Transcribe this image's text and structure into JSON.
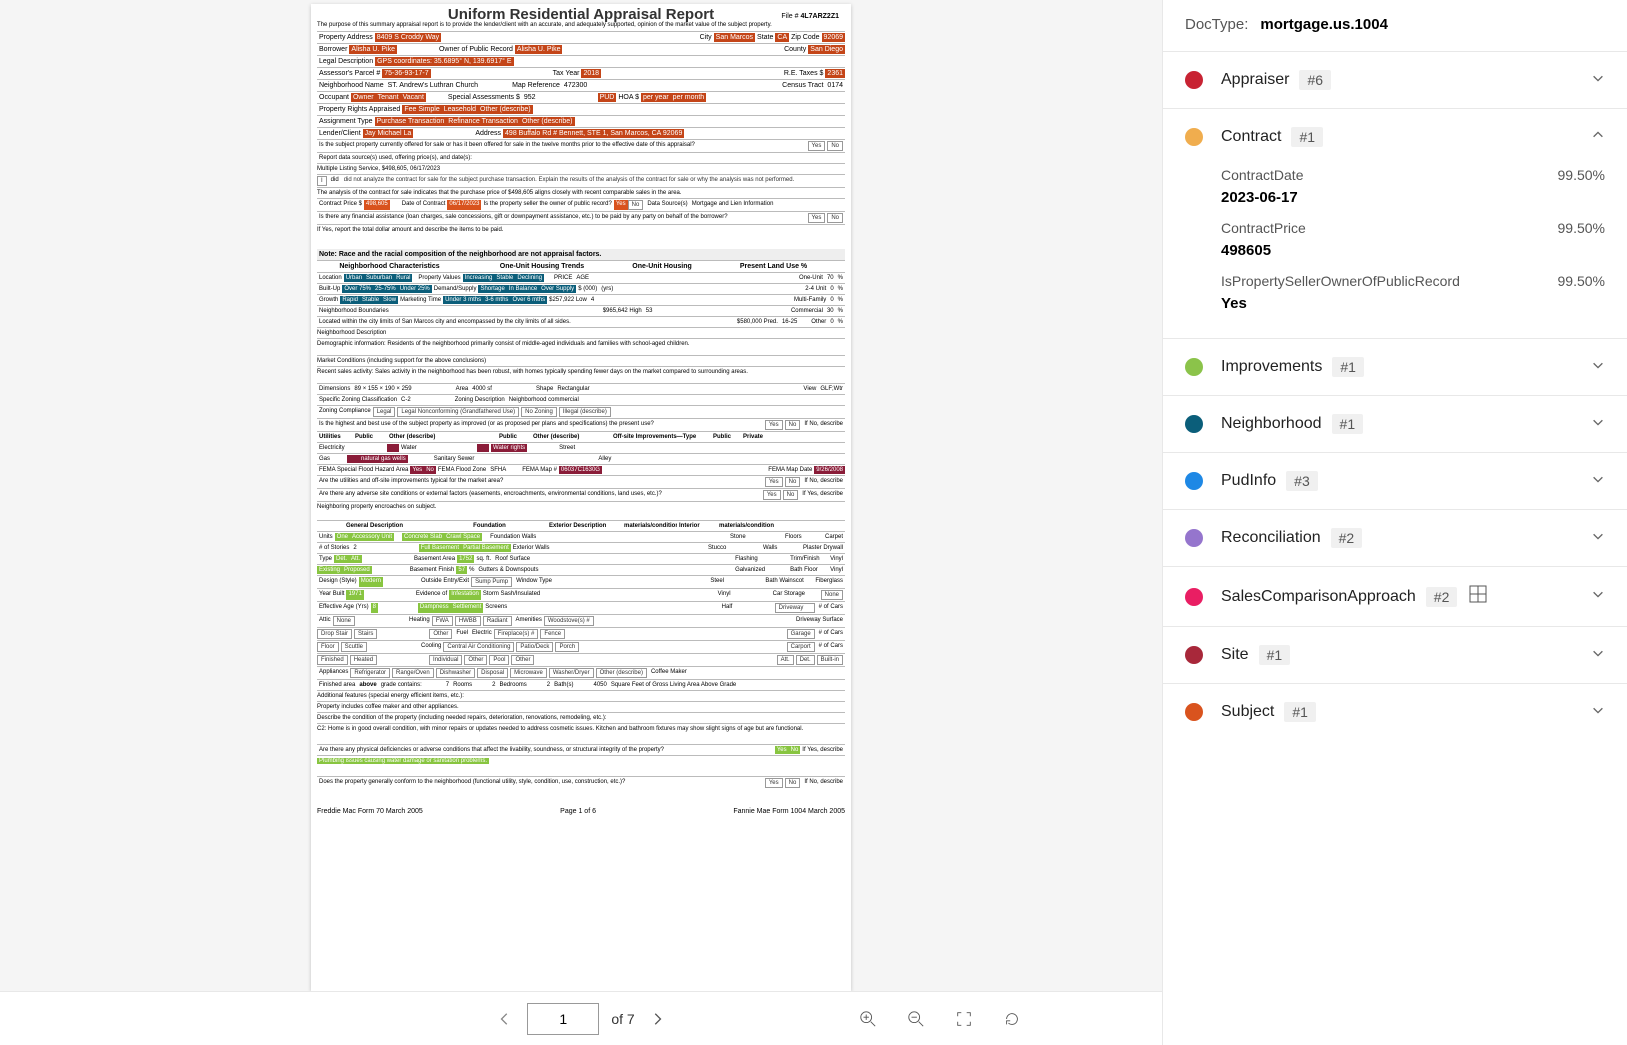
{
  "docType": {
    "label": "DocType:",
    "value": "mortgage.us.1004"
  },
  "pager": {
    "current": "1",
    "total": "7",
    "ofLabel": "of"
  },
  "form": {
    "title": "Uniform Residential Appraisal Report",
    "fileLabel": "File #",
    "fileNo": "4L7ARZ2Z1",
    "intro": "The purpose of this summary appraisal report is to provide the lender/client with an accurate, and adequately supported, opinion of the market value of the subject property.",
    "subject": {
      "propAddrLabel": "Property Address",
      "propAddr": "8409 S Croddy Way",
      "cityLabel": "City",
      "city": "San Marcos",
      "stateLabel": "State",
      "state": "CA",
      "zipLabel": "Zip Code",
      "zip": "92069",
      "borrowerLabel": "Borrower",
      "borrower": "Alisha U. Pike",
      "ownerLabel": "Owner of Public Record",
      "owner": "Alisha U. Pike",
      "countyLabel": "County",
      "county": "San Diego",
      "legalLabel": "Legal Description",
      "legal": "GPS coordinates: 35.6895° N, 139.6917° E",
      "assessorLabel": "Assessor's Parcel #",
      "assessor": "75-36-93-17-7",
      "taxYrLabel": "Tax Year",
      "taxYr": "2018",
      "reTaxLabel": "R.E. Taxes $",
      "reTax": "2361",
      "nbhdLabel": "Neighborhood Name",
      "nbhd": "ST. Andrew's Luthran Church",
      "mapRefLabel": "Map Reference",
      "mapRef": "472300",
      "censusLabel": "Census Tract",
      "census": "0174",
      "occupantLabel": "Occupant",
      "occ1": "Owner",
      "occ2": "Tenant",
      "occ3": "Vacant",
      "assessLabel": "Special Assessments $",
      "assess": "952",
      "pudLabel": "PUD",
      "hoaLabel": "HOA $",
      "hoaPer1": "per year",
      "hoaPer2": "per month",
      "rightsLabel": "Property Rights Appraised",
      "rights1": "Fee Simple",
      "rights2": "Leasehold",
      "rights3": "Other (describe)",
      "assignLabel": "Assignment Type",
      "assign1": "Purchase Transaction",
      "assign2": "Refinance Transaction",
      "assign3": "Other (describe)",
      "lenderLabel": "Lender/Client",
      "lender": "Jay Michael La",
      "addrLabel": "Address",
      "lenderAddr": "498 Buffalo Rd # Bennett, STE 1, San Marcos, CA 92069",
      "offered": "Is the subject property currently offered for sale or has it been offered for sale in the twelve months prior to the effective date of this appraisal?",
      "yes": "Yes",
      "no": "No",
      "sourcesLabel": "Report data source(s) used, offering price(s), and date(s):",
      "sources": "Multiple Listing Service, $498,605, 06/17/2023"
    },
    "contract": {
      "analyze": "I",
      "didnot": "did",
      "didnotAnalyze": "did not analyze the contract for sale for the subject purchase transaction. Explain the results of the analysis of the contract for sale or why the analysis was not performed.",
      "analysisText": "The analysis of the contract for sale indicates that the purchase price of $498,605 aligns closely with recent comparable sales in the area.",
      "priceLabel": "Contract Price $",
      "price": "498,605",
      "dateLabel": "Date of Contract",
      "date": "06/17/2023",
      "sellerOwnerLabel": "Is the property seller the owner of public record?",
      "sellerYes": "Yes",
      "sellerNo": "No",
      "dataSourceLabel": "Data Source(s)",
      "dataSource": "Mortgage and Lien Information",
      "finAssist": "Is there any financial assistance (loan charges, sale concessions, gift or downpayment assistance, etc.) to be paid by any party on behalf of the borrower?",
      "ifYes": "If Yes, report the total dollar amount and describe the items to be paid."
    },
    "nbhd": {
      "note": "Note: Race and the racial composition of the neighborhood are not appraisal factors.",
      "h1": "Neighborhood Characteristics",
      "h2": "One-Unit Housing Trends",
      "h3": "One-Unit Housing",
      "h4": "Present Land Use %",
      "locLabel": "Location",
      "urban": "Urban",
      "suburban": "Suburban",
      "rural": "Rural",
      "valLabel": "Property Values",
      "inc": "Increasing",
      "stab": "Stable",
      "dec": "Declining",
      "priceH": "PRICE",
      "ageH": "AGE",
      "oneUnit": "One-Unit",
      "oneUnitV": "70",
      "pct": "%",
      "builtLabel": "Built-Up",
      "o75": "Over 75%",
      "b25": "25-75%",
      "u25": "Under 25%",
      "dsLabel": "Demand/Supply",
      "short": "Shortage",
      "bal": "In Balance",
      "over": "Over Supply",
      "k000": "$ (000)",
      "yrs": "(yrs)",
      "twoFour": "2-4 Unit",
      "twoFourV": "0",
      "growthLabel": "Growth",
      "rapid": "Rapid",
      "stable": "Stable",
      "slow": "Slow",
      "mktLabel": "Marketing Time",
      "u3": "Under 3 mths",
      "b36": "3-6 mths",
      "o6": "Over 6 mths",
      "lowL": "$257,922 Low",
      "lowR": "4",
      "multi": "Multi-Family",
      "multiV": "0",
      "highL": "$965,642 High",
      "highR": "53",
      "comm": "Commercial",
      "commV": "30",
      "predL": "$580,000 Pred.",
      "predR": "16-25",
      "other": "Other",
      "otherV": "0",
      "boundLabel": "Neighborhood Boundaries",
      "bound": "Located within the city limits of San Marcos city and encompassed by the city limits of all sides.",
      "descLabel": "Neighborhood Description",
      "desc": "Demographic information: Residents of the neighborhood primarily consist of middle-aged individuals and families with school-aged children.",
      "mktCondLabel": "Market Conditions (including support for the above conclusions)",
      "mktCond": "Recent sales activity: Sales activity in the neighborhood has been robust, with homes typically spending fewer days on the market compared to surrounding areas."
    },
    "site": {
      "dimLabel": "Dimensions",
      "dim": "89 × 155 × 190 × 259",
      "areaLabel": "Area",
      "area": "4000 sf",
      "shapeLabel": "Shape",
      "shape": "Rectangular",
      "viewLabel": "View",
      "view": "GLF;Wtr",
      "zoneLabel": "Specific Zoning Classification",
      "zone": "C-2",
      "zoneDescLabel": "Zoning Description",
      "zoneDesc": "Neighborhood commercial",
      "zcLabel": "Zoning Compliance",
      "leg": "Legal",
      "legnc": "Legal Nonconforming (Grandfathered Use)",
      "noz": "No Zoning",
      "illeg": "Illegal (describe)",
      "hbLabel": "Is the highest and best use of the subject property as improved (or as proposed per plans and specifications) the present use?",
      "utilH": "Utilities",
      "pubH": "Public",
      "othH": "Other (describe)",
      "offH": "Off-site Improvements—Type",
      "privH": "Private",
      "elec": "Electricity",
      "water": "Water",
      "street": "Street",
      "gas": "Gas",
      "gasOth": "natural gas wells",
      "san": "Sanitary Sewer",
      "waterOth": "Water rights",
      "alley": "Alley",
      "femaLabel": "FEMA Special Flood Hazard Area",
      "femaZone": "FEMA Flood Zone",
      "femaZoneV": "SFHA",
      "femaMap": "FEMA Map #",
      "femaMapV": "06037C1630G",
      "femaDate": "FEMA Map Date",
      "femaDateV": "9/26/2008",
      "utilQ": "Are the utilities and off-site improvements typical for the market area?",
      "advQ": "Are there any adverse site conditions or external factors (easements, encroachments, environmental conditions, land uses, etc.)?",
      "advIfNo": "If No, describe",
      "encroach": "Neighboring property encroaches on subject."
    },
    "impr": {
      "gdH": "General Description",
      "fndH": "Foundation",
      "extH": "Exterior Description",
      "mcH": "materials/condition",
      "intH": "Interior",
      "unitsLabel": "Units",
      "one": "One",
      "accLabel": "Accessory Unit",
      "concLabel": "Concrete Slab",
      "crawlLabel": "Crawl Space",
      "fwLabel": "Foundation Walls",
      "fwV": "Stone",
      "flLabel": "Floors",
      "flV": "Carpet",
      "storyLabel": "# of Stories",
      "storyV": "2",
      "fullBLabel": "Full Basement",
      "partBLabel": "Partial Basement",
      "ewLabel": "Exterior Walls",
      "ewV": "Stucco",
      "wLabel": "Walls",
      "wV": "Plaster Drywall",
      "typeLabel": "Type",
      "det": "Det.",
      "att": "Att.",
      "baLabel": "Basement Area",
      "baV": "1752",
      "sqft": "sq. ft.",
      "rsLabel": "Roof Surface",
      "rsV": "Flashing",
      "tfLabel": "Trim/Finish",
      "tfV": "Vinyl",
      "exLabel": "Existing",
      "propLabel": "Proposed",
      "bfLabel": "Basement Finish",
      "bfV": "57",
      "pct": "%",
      "gdLabel": "Gutters & Downspouts",
      "gdV": "Galvanized",
      "bflLabel": "Bath Floor",
      "bflV": "Vinyl",
      "dsLabel": "Design (Style)",
      "dsV": "Modern",
      "oeLabel": "Outside Entry/Exit",
      "sump": "Sump Pump",
      "wtLabel": "Window Type",
      "wtV": "Steel",
      "bwLabel": "Bath Wainscot",
      "bwV": "Fiberglass",
      "ybLabel": "Year Built",
      "ybV": "1971",
      "evLabel": "Evidence of",
      "infest": "Infestation",
      "ssLabel": "Storm Sash/Insulated",
      "ssV": "Vinyl",
      "csLabel": "Car Storage",
      "none": "None",
      "eaLabel": "Effective Age (Yrs)",
      "eaV": "8",
      "dampLabel": "Dampness",
      "settLabel": "Settlement",
      "scrLabel": "Screens",
      "scrV": "Half",
      "dwLabel": "Driveway",
      "ncLabel": "# of Cars",
      "atticLabel": "Attic",
      "heatLabel": "Heating",
      "fwa": "FWA",
      "hwbb": "HWBB",
      "rad": "Radiant",
      "amenLabel": "Amenities",
      "woodLabel": "Woodstove(s) #",
      "dsurfLabel": "Driveway Surface",
      "dropLabel": "Drop Stair",
      "stairsLabel": "Stairs",
      "other": "Other",
      "fuelLabel": "Fuel",
      "fuelV": "Electric",
      "fpLabel": "Fireplace(s) #",
      "fenceLabel": "Fence",
      "garLabel": "Garage",
      "floorLabel": "Floor",
      "scutLabel": "Scuttle",
      "coolLabel": "Cooling",
      "cac": "Central Air Conditioning",
      "pdLabel": "Patio/Deck",
      "porchLabel": "Porch",
      "carportLabel": "Carport",
      "finLabel": "Finished",
      "heatedLabel": "Heated",
      "indLabel": "Individual",
      "poolLabel": "Pool",
      "attLabel": "Att.",
      "detLabel": "Det.",
      "biLabel": "Built-in",
      "applLabel": "Appliances",
      "refrig": "Refrigerator",
      "rangeov": "Range/Oven",
      "dishw": "Dishwasher",
      "disp": "Disposal",
      "micro": "Microwave",
      "washdry": "Washer/Dryer",
      "otherDesc": "Other (describe)",
      "coffeeMaker": "Coffee Maker",
      "finAreaLabel": "Finished area",
      "aboveGrade": "above",
      "gradeContains": "grade contains:",
      "rooms": "7",
      "roomsL": "Rooms",
      "bedrooms": "2",
      "bedroomsL": "Bedrooms",
      "baths": "2",
      "bathsL": "Bath(s)",
      "sqftV": "4050",
      "sqftL": "Square Feet of Gross Living Area Above Grade",
      "addlFeatLabel": "Additional features (special energy efficient items, etc.):",
      "addlFeat": "Property includes coffee maker and other appliances.",
      "condLabel": "Describe the condition of the property (including needed repairs, deterioration, renovations, remodeling, etc.):",
      "cond": "C2: Home is in good overall condition, with minor repairs or updates needed to address cosmetic issues. Kitchen and bathroom fixtures may show slight signs of age but are functional.",
      "defQ": "Are there any physical deficiencies or adverse conditions that affect the livability, soundness, or structural integrity of the property?",
      "defYes": "Yes",
      "defNo": "No",
      "defIf": "If Yes, describe",
      "defA": "Plumbing issues causing water damage or sanitation problems.",
      "confQ": "Does the property generally conform to the neighborhood (functional utility, style, condition, use, construction, etc.)?"
    },
    "footer": {
      "left": "Freddie Mac Form 70  March 2005",
      "center": "Page 1 of 6",
      "right": "Fannie Mae Form 1004  March 2005"
    }
  },
  "sections": [
    {
      "id": "appraiser",
      "title": "Appraiser",
      "badge": "#6",
      "color": "#c82333",
      "open": false
    },
    {
      "id": "contract",
      "title": "Contract",
      "badge": "#1",
      "color": "#f0ad4e",
      "open": true,
      "fields": [
        {
          "label": "ContractDate",
          "conf": "99.50%",
          "value": "2023-06-17"
        },
        {
          "label": "ContractPrice",
          "conf": "99.50%",
          "value": "498605"
        },
        {
          "label": "IsPropertySellerOwnerOfPublicRecord",
          "conf": "99.50%",
          "value": "Yes"
        }
      ]
    },
    {
      "id": "improvements",
      "title": "Improvements",
      "badge": "#1",
      "color": "#8bc34a",
      "open": false
    },
    {
      "id": "neighborhood",
      "title": "Neighborhood",
      "badge": "#1",
      "color": "#0b5e7a",
      "open": false
    },
    {
      "id": "pudinfo",
      "title": "PudInfo",
      "badge": "#3",
      "color": "#1e88e5",
      "open": false
    },
    {
      "id": "reconciliation",
      "title": "Reconciliation",
      "badge": "#2",
      "color": "#9575cd",
      "open": false
    },
    {
      "id": "salescomp",
      "title": "SalesComparisonApproach",
      "badge": "#2",
      "color": "#e91e63",
      "open": false,
      "grid": true
    },
    {
      "id": "site",
      "title": "Site",
      "badge": "#1",
      "color": "#a8283a",
      "open": false
    },
    {
      "id": "subject",
      "title": "Subject",
      "badge": "#1",
      "color": "#d9531e",
      "open": false
    }
  ]
}
